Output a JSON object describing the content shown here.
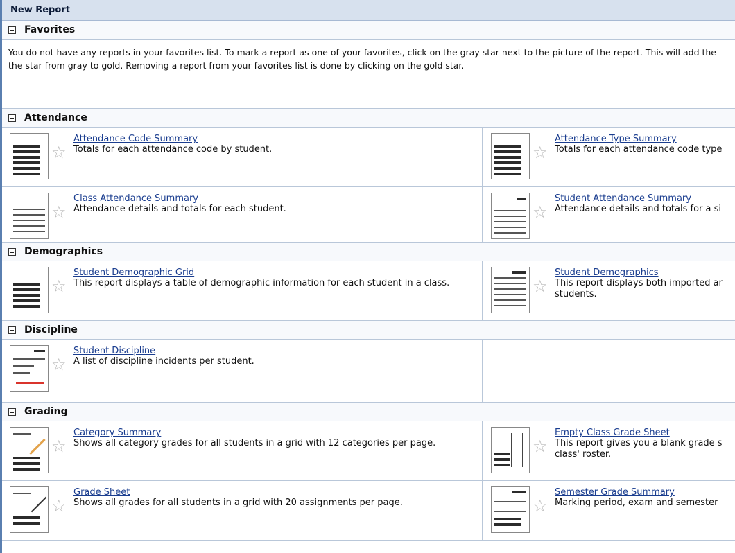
{
  "window": {
    "title": "New Report"
  },
  "favorites": {
    "title": "Favorites",
    "message_line1": "You do not have any reports in your favorites list. To mark a report as one of your favorites, click on the gray star next to the picture of the report. This will add the",
    "message_line2": "the star from gray to gold. Removing a report from your favorites list is done by clicking on the gold star."
  },
  "attendance": {
    "title": "Attendance",
    "reports": [
      {
        "name": "Attendance Code Summary",
        "desc": "Totals for each attendance code by student."
      },
      {
        "name": "Attendance Type Summary",
        "desc": "Totals for each attendance code type"
      },
      {
        "name": "Class Attendance Summary",
        "desc": "Attendance details and totals for each student."
      },
      {
        "name": "Student Attendance Summary",
        "desc": "Attendance details and totals for a si"
      }
    ]
  },
  "demographics": {
    "title": "Demographics",
    "reports": [
      {
        "name": "Student Demographic Grid",
        "desc": "This report displays a table of demographic information for each student in a class."
      },
      {
        "name": "Student Demographics",
        "desc": "This report displays both imported ar",
        "desc2": "students."
      }
    ]
  },
  "discipline": {
    "title": "Discipline",
    "reports": [
      {
        "name": "Student Discipline",
        "desc": "A list of discipline incidents per student."
      }
    ]
  },
  "grading": {
    "title": "Grading",
    "reports": [
      {
        "name": "Category Summary",
        "desc": "Shows all category grades for all students in a grid with 12 categories per page."
      },
      {
        "name": "Empty Class Grade Sheet",
        "desc": "This report gives you a blank grade s",
        "desc2": "class' roster."
      },
      {
        "name": "Grade Sheet",
        "desc": "Shows all grades for all students in a grid with 20 assignments per page."
      },
      {
        "name": "Semester Grade Summary",
        "desc": "Marking period, exam and semester"
      }
    ]
  },
  "icons": {
    "star": "star-icon",
    "collapse": "collapse-icon"
  },
  "colors": {
    "link": "#1a3d8f",
    "title_bar": "#d7e1ee",
    "star_gray": "#b9b9b9",
    "border": "#b9c7d9"
  }
}
